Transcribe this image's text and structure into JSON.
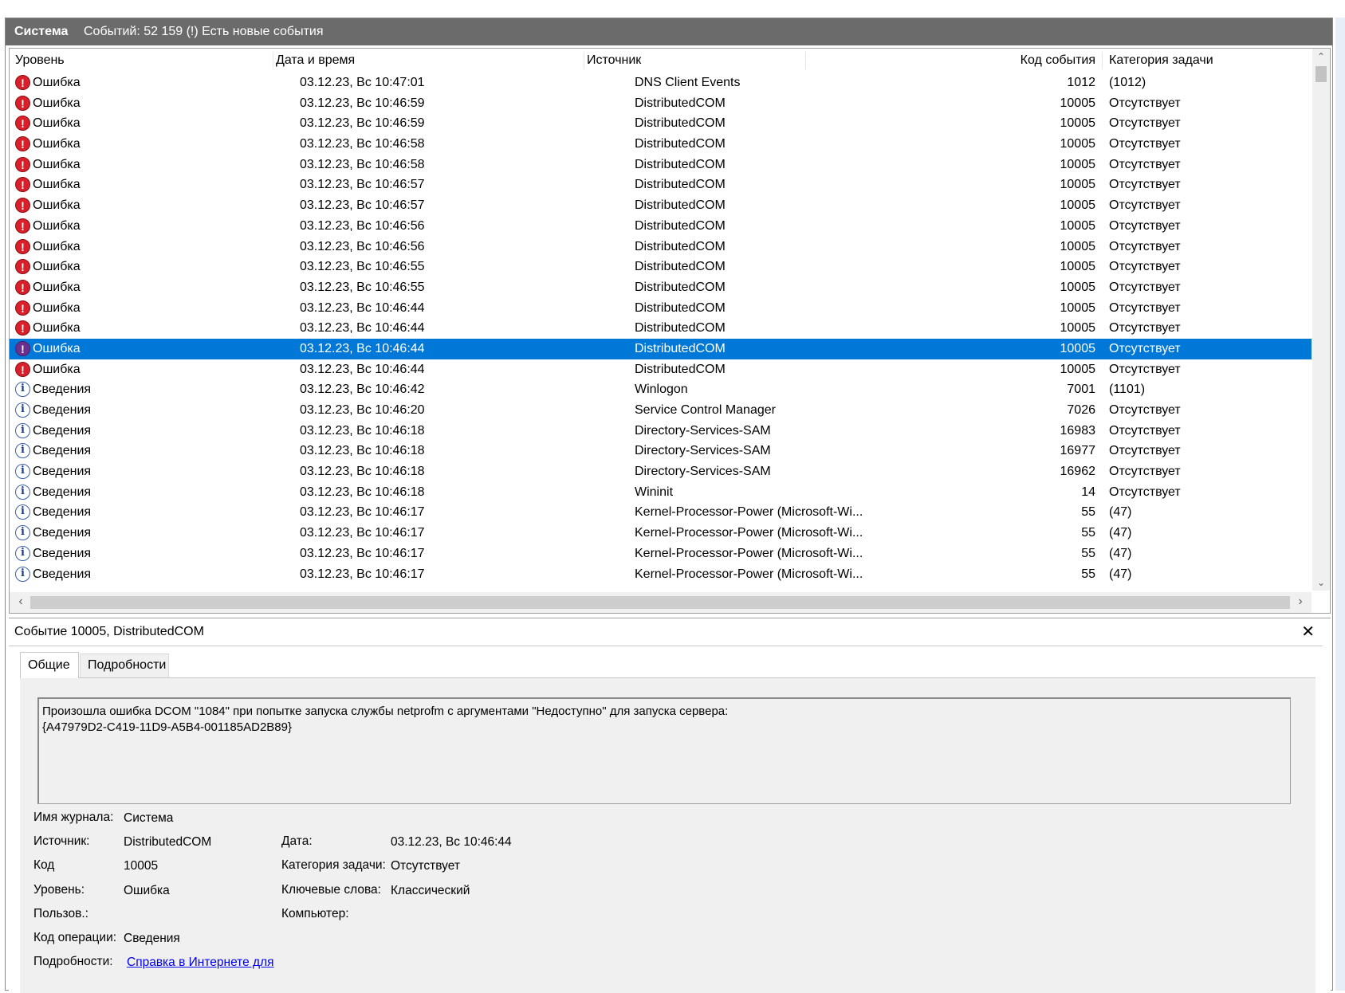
{
  "titlebar": {
    "log_name": "Система",
    "info": "Событий: 52 159 (!) Есть новые события"
  },
  "columns": {
    "level": "Уровень",
    "datetime": "Дата и время",
    "source": "Источник",
    "event_id": "Код события",
    "category": "Категория задачи"
  },
  "rows": [
    {
      "level": "Ошибка",
      "type": "error",
      "datetime": "03.12.23, Вс 10:47:01",
      "source": "DNS Client Events",
      "event_id": "1012",
      "category": "(1012)"
    },
    {
      "level": "Ошибка",
      "type": "error",
      "datetime": "03.12.23, Вс 10:46:59",
      "source": "DistributedCOM",
      "event_id": "10005",
      "category": "Отсутствует"
    },
    {
      "level": "Ошибка",
      "type": "error",
      "datetime": "03.12.23, Вс 10:46:59",
      "source": "DistributedCOM",
      "event_id": "10005",
      "category": "Отсутствует"
    },
    {
      "level": "Ошибка",
      "type": "error",
      "datetime": "03.12.23, Вс 10:46:58",
      "source": "DistributedCOM",
      "event_id": "10005",
      "category": "Отсутствует"
    },
    {
      "level": "Ошибка",
      "type": "error",
      "datetime": "03.12.23, Вс 10:46:58",
      "source": "DistributedCOM",
      "event_id": "10005",
      "category": "Отсутствует"
    },
    {
      "level": "Ошибка",
      "type": "error",
      "datetime": "03.12.23, Вс 10:46:57",
      "source": "DistributedCOM",
      "event_id": "10005",
      "category": "Отсутствует"
    },
    {
      "level": "Ошибка",
      "type": "error",
      "datetime": "03.12.23, Вс 10:46:57",
      "source": "DistributedCOM",
      "event_id": "10005",
      "category": "Отсутствует"
    },
    {
      "level": "Ошибка",
      "type": "error",
      "datetime": "03.12.23, Вс 10:46:56",
      "source": "DistributedCOM",
      "event_id": "10005",
      "category": "Отсутствует"
    },
    {
      "level": "Ошибка",
      "type": "error",
      "datetime": "03.12.23, Вс 10:46:56",
      "source": "DistributedCOM",
      "event_id": "10005",
      "category": "Отсутствует"
    },
    {
      "level": "Ошибка",
      "type": "error",
      "datetime": "03.12.23, Вс 10:46:55",
      "source": "DistributedCOM",
      "event_id": "10005",
      "category": "Отсутствует"
    },
    {
      "level": "Ошибка",
      "type": "error",
      "datetime": "03.12.23, Вс 10:46:55",
      "source": "DistributedCOM",
      "event_id": "10005",
      "category": "Отсутствует"
    },
    {
      "level": "Ошибка",
      "type": "error",
      "datetime": "03.12.23, Вс 10:46:44",
      "source": "DistributedCOM",
      "event_id": "10005",
      "category": "Отсутствует"
    },
    {
      "level": "Ошибка",
      "type": "error",
      "datetime": "03.12.23, Вс 10:46:44",
      "source": "DistributedCOM",
      "event_id": "10005",
      "category": "Отсутствует"
    },
    {
      "level": "Ошибка",
      "type": "error",
      "datetime": "03.12.23, Вс 10:46:44",
      "source": "DistributedCOM",
      "event_id": "10005",
      "category": "Отсутствует",
      "selected": true
    },
    {
      "level": "Ошибка",
      "type": "error",
      "datetime": "03.12.23, Вс 10:46:44",
      "source": "DistributedCOM",
      "event_id": "10005",
      "category": "Отсутствует"
    },
    {
      "level": "Сведения",
      "type": "info",
      "datetime": "03.12.23, Вс 10:46:42",
      "source": "Winlogon",
      "event_id": "7001",
      "category": "(1101)"
    },
    {
      "level": "Сведения",
      "type": "info",
      "datetime": "03.12.23, Вс 10:46:20",
      "source": "Service Control Manager",
      "event_id": "7026",
      "category": "Отсутствует"
    },
    {
      "level": "Сведения",
      "type": "info",
      "datetime": "03.12.23, Вс 10:46:18",
      "source": "Directory-Services-SAM",
      "event_id": "16983",
      "category": "Отсутствует"
    },
    {
      "level": "Сведения",
      "type": "info",
      "datetime": "03.12.23, Вс 10:46:18",
      "source": "Directory-Services-SAM",
      "event_id": "16977",
      "category": "Отсутствует"
    },
    {
      "level": "Сведения",
      "type": "info",
      "datetime": "03.12.23, Вс 10:46:18",
      "source": "Directory-Services-SAM",
      "event_id": "16962",
      "category": "Отсутствует"
    },
    {
      "level": "Сведения",
      "type": "info",
      "datetime": "03.12.23, Вс 10:46:18",
      "source": "Wininit",
      "event_id": "14",
      "category": "Отсутствует"
    },
    {
      "level": "Сведения",
      "type": "info",
      "datetime": "03.12.23, Вс 10:46:17",
      "source": "Kernel-Processor-Power (Microsoft-Wi...",
      "event_id": "55",
      "category": "(47)"
    },
    {
      "level": "Сведения",
      "type": "info",
      "datetime": "03.12.23, Вс 10:46:17",
      "source": "Kernel-Processor-Power (Microsoft-Wi...",
      "event_id": "55",
      "category": "(47)"
    },
    {
      "level": "Сведения",
      "type": "info",
      "datetime": "03.12.23, Вс 10:46:17",
      "source": "Kernel-Processor-Power (Microsoft-Wi...",
      "event_id": "55",
      "category": "(47)"
    },
    {
      "level": "Сведения",
      "type": "info",
      "datetime": "03.12.23, Вс 10:46:17",
      "source": "Kernel-Processor-Power (Microsoft-Wi...",
      "event_id": "55",
      "category": "(47)"
    }
  ],
  "icons": {
    "error": "error-icon",
    "info": "info-icon"
  },
  "colors": {
    "selection": "#0078d7",
    "titlebar": "#6b6b6b",
    "error": "#d9202a"
  },
  "detail": {
    "title": "Событие 10005, DistributedCOM",
    "tabs": [
      "Общие",
      "Подробности"
    ],
    "message_line1": "Произошла ошибка DCOM \"1084\" при попытке запуска службы netprofm с аргументами \"Недоступно\" для запуска сервера:",
    "message_line2": "{A47979D2-C419-11D9-A5B4-001185AD2B89}",
    "fields": {
      "log_label": "Имя журнала:",
      "log_value": "Система",
      "source_label": "Источник:",
      "source_value": "DistributedCOM",
      "date_label": "Дата:",
      "date_value": "03.12.23, Вс 10:46:44",
      "id_label": "Код",
      "id_value": "10005",
      "category_label": "Категория задачи:",
      "category_value": "Отсутствует",
      "level_label": "Уровень:",
      "level_value": "Ошибка",
      "keywords_label": "Ключевые слова:",
      "keywords_value": "Классический",
      "user_label": "Пользов.:",
      "computer_label": "Компьютер:",
      "opcode_label": "Код операции:",
      "opcode_value": "Сведения",
      "more_label": "Подробности:",
      "more_link": "Справка в Интернете для "
    }
  }
}
